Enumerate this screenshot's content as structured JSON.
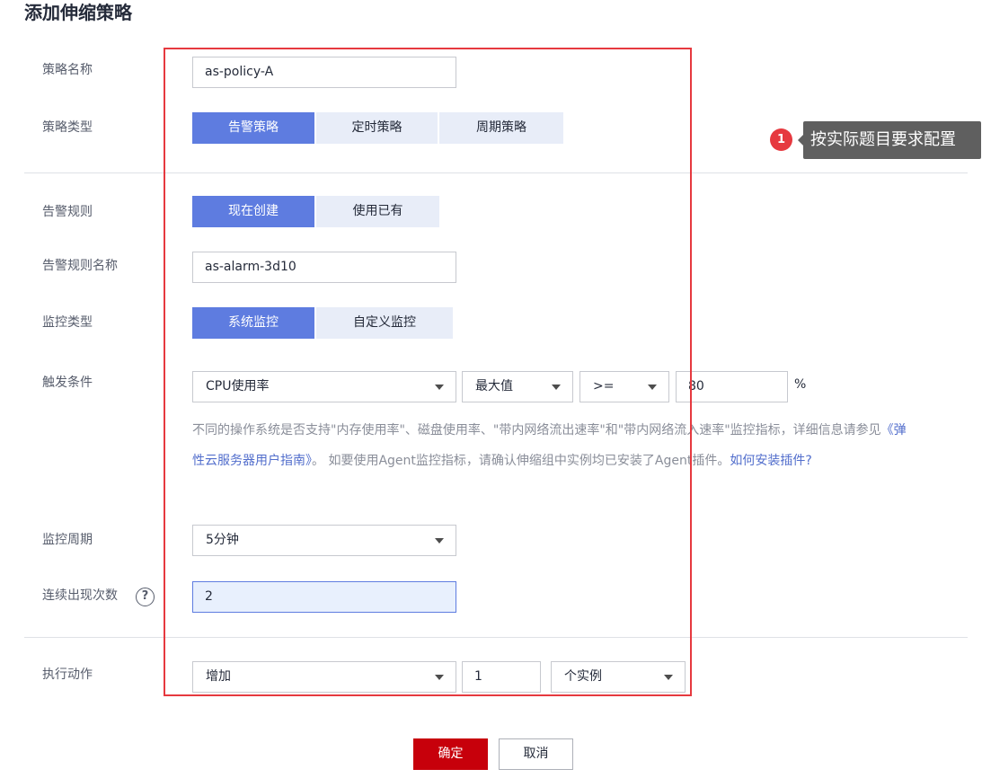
{
  "page_title": "添加伸缩策略",
  "fields": {
    "policy_name": {
      "label": "策略名称",
      "value": "as-policy-A"
    },
    "policy_type": {
      "label": "策略类型",
      "options": [
        "告警策略",
        "定时策略",
        "周期策略"
      ],
      "selected": "告警策略"
    },
    "alarm_rule": {
      "label": "告警规则",
      "options": [
        "现在创建",
        "使用已有"
      ],
      "selected": "现在创建"
    },
    "alarm_rule_name": {
      "label": "告警规则名称",
      "value": "as-alarm-3d10"
    },
    "monitor_type": {
      "label": "监控类型",
      "options": [
        "系统监控",
        "自定义监控"
      ],
      "selected": "系统监控"
    },
    "trigger": {
      "label": "触发条件",
      "metric": "CPU使用率",
      "aggregation": "最大值",
      "operator": ">=",
      "threshold": "80",
      "unit": "%"
    },
    "help": {
      "text_1": "不同的操作系统是否支持\"内存使用率\"、磁盘使用率、\"带内网络流出速率\"和\"带内网络流入速率\"监控指标，详细信息请参见",
      "link_1": "《弹性云服务器用户指南》",
      "text_2": "。 如要使用Agent监控指标，请确认伸缩组中实例均已安装了Agent插件。",
      "link_2": "如何安装插件?"
    },
    "monitor_period": {
      "label": "监控周期",
      "value": "5分钟"
    },
    "consecutive_count": {
      "label": "连续出现次数",
      "value": "2",
      "help_icon": "?"
    },
    "action": {
      "label": "执行动作",
      "operation": "增加",
      "count": "1",
      "unit": "个实例"
    }
  },
  "annotation": {
    "badge": "1",
    "tooltip": "按实际题目要求配置"
  },
  "buttons": {
    "confirm": "确定",
    "cancel": "取消"
  },
  "colors": {
    "accent": "#5e7ce0",
    "primary_button": "#c7000b",
    "highlight_border": "#e6393f"
  }
}
